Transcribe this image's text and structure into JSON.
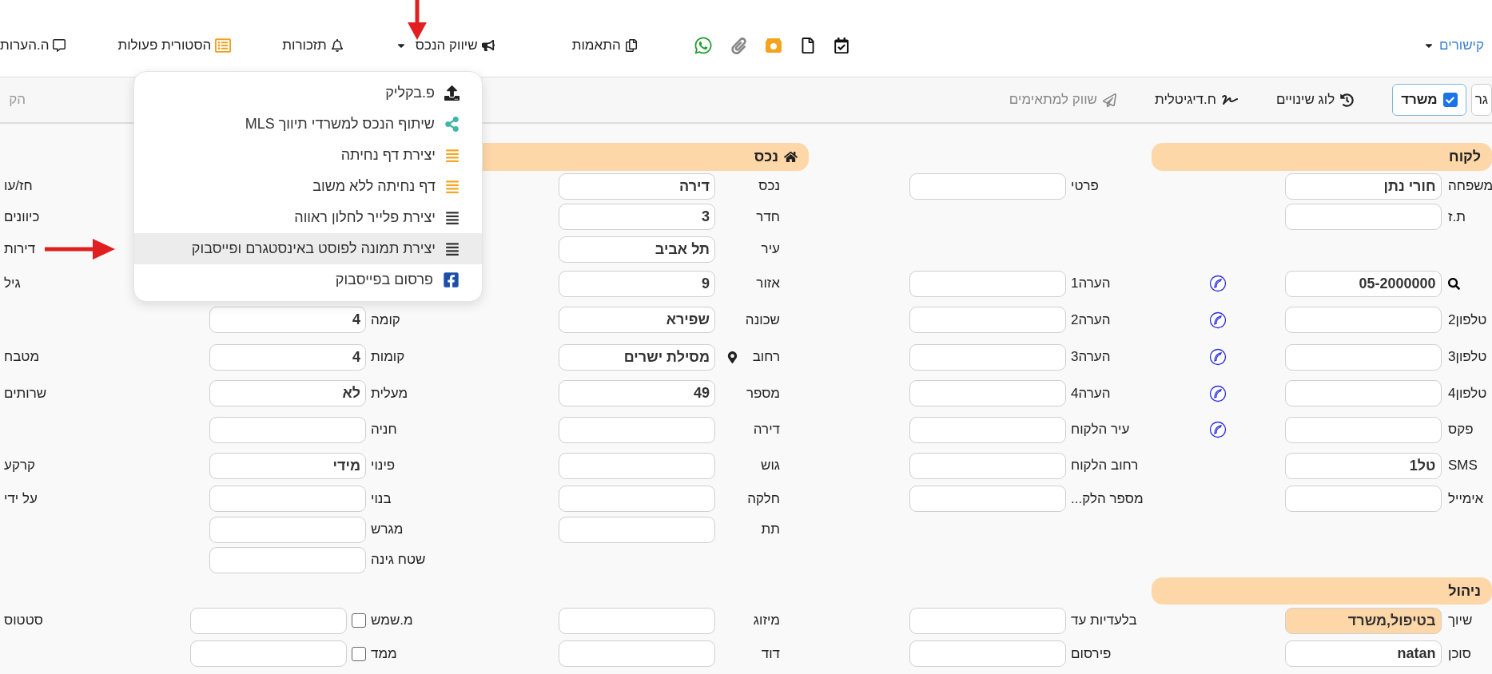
{
  "top_bar": {
    "links_menu": "קישורים",
    "actions": [
      {
        "label": "התאמות",
        "kind": "matches"
      },
      {
        "label": "שיווק הנכס",
        "kind": "marketing"
      },
      {
        "label": "תזכורות",
        "kind": "reminders"
      },
      {
        "label": "הסטורית פעולות",
        "kind": "history"
      },
      {
        "label": "ה.הערות",
        "kind": "notes"
      }
    ]
  },
  "marketing_menu": [
    {
      "label": "פ.בקליק",
      "kind": "upload",
      "highlighted": false
    },
    {
      "label": "שיתוף הנכס למשרדי תיווך MLS",
      "kind": "share",
      "highlighted": false
    },
    {
      "label": "יצירת דף נחיתה",
      "kind": "landing",
      "highlighted": false
    },
    {
      "label": "דף נחיתה ללא משוב",
      "kind": "landing",
      "highlighted": false
    },
    {
      "label": "יצירת פלייר לחלון ראווה",
      "kind": "document",
      "highlighted": false
    },
    {
      "label": "יצירת תמונה לפוסט באינסטגרם ופייסבוק",
      "kind": "document",
      "highlighted": true
    },
    {
      "label": "פרסום בפייסבוק",
      "kind": "facebook",
      "highlighted": false
    }
  ],
  "toolbar": {
    "buttons": [
      {
        "label": "גר",
        "kind": "plain",
        "disabled": false
      },
      {
        "label": "משרד",
        "kind": "check",
        "checked": true,
        "disabled": false
      },
      {
        "label": "לוג שינויים",
        "kind": "history",
        "disabled": false
      },
      {
        "label": "ח.דיגיטלית",
        "kind": "signature",
        "disabled": false
      },
      {
        "label": "שווק למתאימים",
        "kind": "send",
        "disabled": true
      }
    ],
    "search": {
      "placeholder": "הק"
    }
  },
  "form": {
    "headers": {
      "customer": "לקוח",
      "property": "נכס"
    },
    "rows": [
      {
        "customer": {
          "label": "משפחה",
          "value": "חורי נתן"
        },
        "note": {
          "label": "פרטי"
        },
        "property": {
          "label": "נכס",
          "value": "דירה"
        },
        "extra": {
          "label": "חז/עו"
        }
      },
      {
        "customer": {
          "label": "ת.ז"
        },
        "property": {
          "label": "חדר",
          "value": "3"
        },
        "extra": {
          "label": "כיוונים"
        }
      },
      {
        "property": {
          "label": "עיר",
          "value": "תל אביב"
        },
        "extra": {
          "label": "דירות"
        }
      },
      {
        "customer": {
          "value": "05-2000000",
          "search": true,
          "dial": true
        },
        "note": {
          "label": "הערה1"
        },
        "property": {
          "label": "אזור",
          "value": "9"
        },
        "extra": {
          "label": "גיל"
        }
      },
      {
        "customer": {
          "label": "טלפון2",
          "dial": true
        },
        "note": {
          "label": "הערה2"
        },
        "property": {
          "label": "שכונה",
          "value": "שפירא"
        },
        "details": {
          "label": "קומה",
          "value": "4"
        }
      },
      {
        "customer": {
          "label": "טלפון3",
          "dial": true
        },
        "note": {
          "label": "הערה3"
        },
        "property": {
          "label": "רחוב",
          "value": "מסילת ישרים",
          "pin": true
        },
        "details": {
          "label": "קומות",
          "value": "4"
        },
        "extra": {
          "label": "מטבח"
        }
      },
      {
        "customer": {
          "label": "טלפון4",
          "dial": true
        },
        "note": {
          "label": "הערה4"
        },
        "property": {
          "label": "מספר",
          "value": "49"
        },
        "details": {
          "label": "מעלית",
          "value": "לא"
        },
        "extra": {
          "label": "שרותים"
        }
      },
      {
        "customer": {
          "label": "פקס",
          "dial": true
        },
        "note": {
          "label": "עיר הלקוח"
        },
        "property": {
          "label": "דירה"
        },
        "details": {
          "label": "חניה"
        }
      },
      {
        "customer": {
          "label": "SMS",
          "value": "טל1"
        },
        "note": {
          "label": "רחוב הלקוח"
        },
        "property": {
          "label": "גוש"
        },
        "details": {
          "label": "פינוי",
          "value": "מידי"
        },
        "extra": {
          "label": "קרקע"
        }
      },
      {
        "customer": {
          "label": "אימייל"
        },
        "note": {
          "label": "מספר הלק..."
        },
        "property": {
          "label": "חלקה"
        },
        "details": {
          "label": "בנוי"
        },
        "extra": {
          "label": "על ידי"
        }
      },
      {
        "property": {
          "label": "תת"
        },
        "details": {
          "label": "מגרש"
        }
      },
      {
        "details": {
          "label": "שטח גינה"
        }
      }
    ]
  },
  "management": {
    "header": "ניהול",
    "rows": [
      {
        "customer": {
          "label": "שיוך",
          "value": "בטיפול,משרד",
          "highlighted": true
        },
        "note": {
          "label": "בלעדיות עד"
        },
        "property": {
          "label": "מיזוג"
        },
        "details": {
          "label": "מ.שמש",
          "checked": false
        },
        "extra": {
          "label": "סטטוס"
        }
      },
      {
        "customer": {
          "label": "סוכן",
          "value": "natan",
          "highlighted": false
        },
        "note": {
          "label": "פירסום"
        },
        "property": {
          "label": "דוד"
        },
        "details": {
          "label": "ממד",
          "checked": false
        }
      }
    ]
  }
}
